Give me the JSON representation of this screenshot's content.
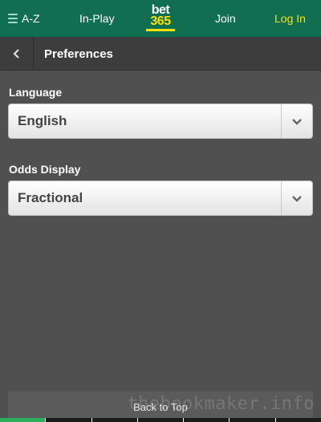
{
  "header": {
    "az_label": "A-Z",
    "inplay_label": "In-Play",
    "logo": {
      "line1": "bet",
      "line2": "365"
    },
    "join_label": "Join",
    "login_label": "Log In"
  },
  "subheader": {
    "title": "Preferences"
  },
  "preferences": {
    "language": {
      "label": "Language",
      "value": "English"
    },
    "odds_display": {
      "label": "Odds Display",
      "value": "Fractional"
    }
  },
  "footer": {
    "back_to_top": "Back to Top"
  },
  "watermark": "thebookmaker.info",
  "colors": {
    "brand_green": "#126e51",
    "accent_yellow": "#ffe000",
    "background": "#505050",
    "tab_active": "#2ab05c"
  }
}
